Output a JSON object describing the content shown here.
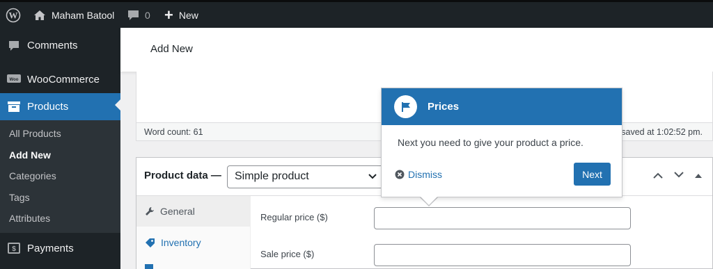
{
  "admin_bar": {
    "site_name": "Maham Batool",
    "comments_count": "0",
    "new_label": "New"
  },
  "sidebar": {
    "menu": [
      {
        "label": "Comments",
        "icon": "comment-icon"
      },
      {
        "label": "WooCommerce",
        "icon": "woocommerce-icon"
      },
      {
        "label": "Products",
        "icon": "archive-icon"
      },
      {
        "label": "Payments",
        "icon": "dollar-icon"
      }
    ],
    "submenu": [
      "All Products",
      "Add New",
      "Categories",
      "Tags",
      "Attributes"
    ]
  },
  "header": {
    "title": "Add New"
  },
  "editor": {
    "word_count": "Word count: 61",
    "saved_text": "saved at 1:02:52 pm."
  },
  "product_data": {
    "title": "Product data —",
    "type_selected": "Simple product",
    "tabs": [
      {
        "label": "General",
        "icon": "wrench-icon"
      },
      {
        "label": "Inventory",
        "icon": "tag-icon"
      }
    ],
    "fields": [
      {
        "label": "Regular price ($)",
        "value": ""
      },
      {
        "label": "Sale price ($)",
        "value": ""
      }
    ]
  },
  "pointer": {
    "title": "Prices",
    "body": "Next you need to give your product a price.",
    "dismiss_label": "Dismiss",
    "next_label": "Next"
  },
  "colors": {
    "admin_dark": "#1d2327",
    "accent": "#2271b1",
    "submenu_bg": "#2c3338"
  }
}
